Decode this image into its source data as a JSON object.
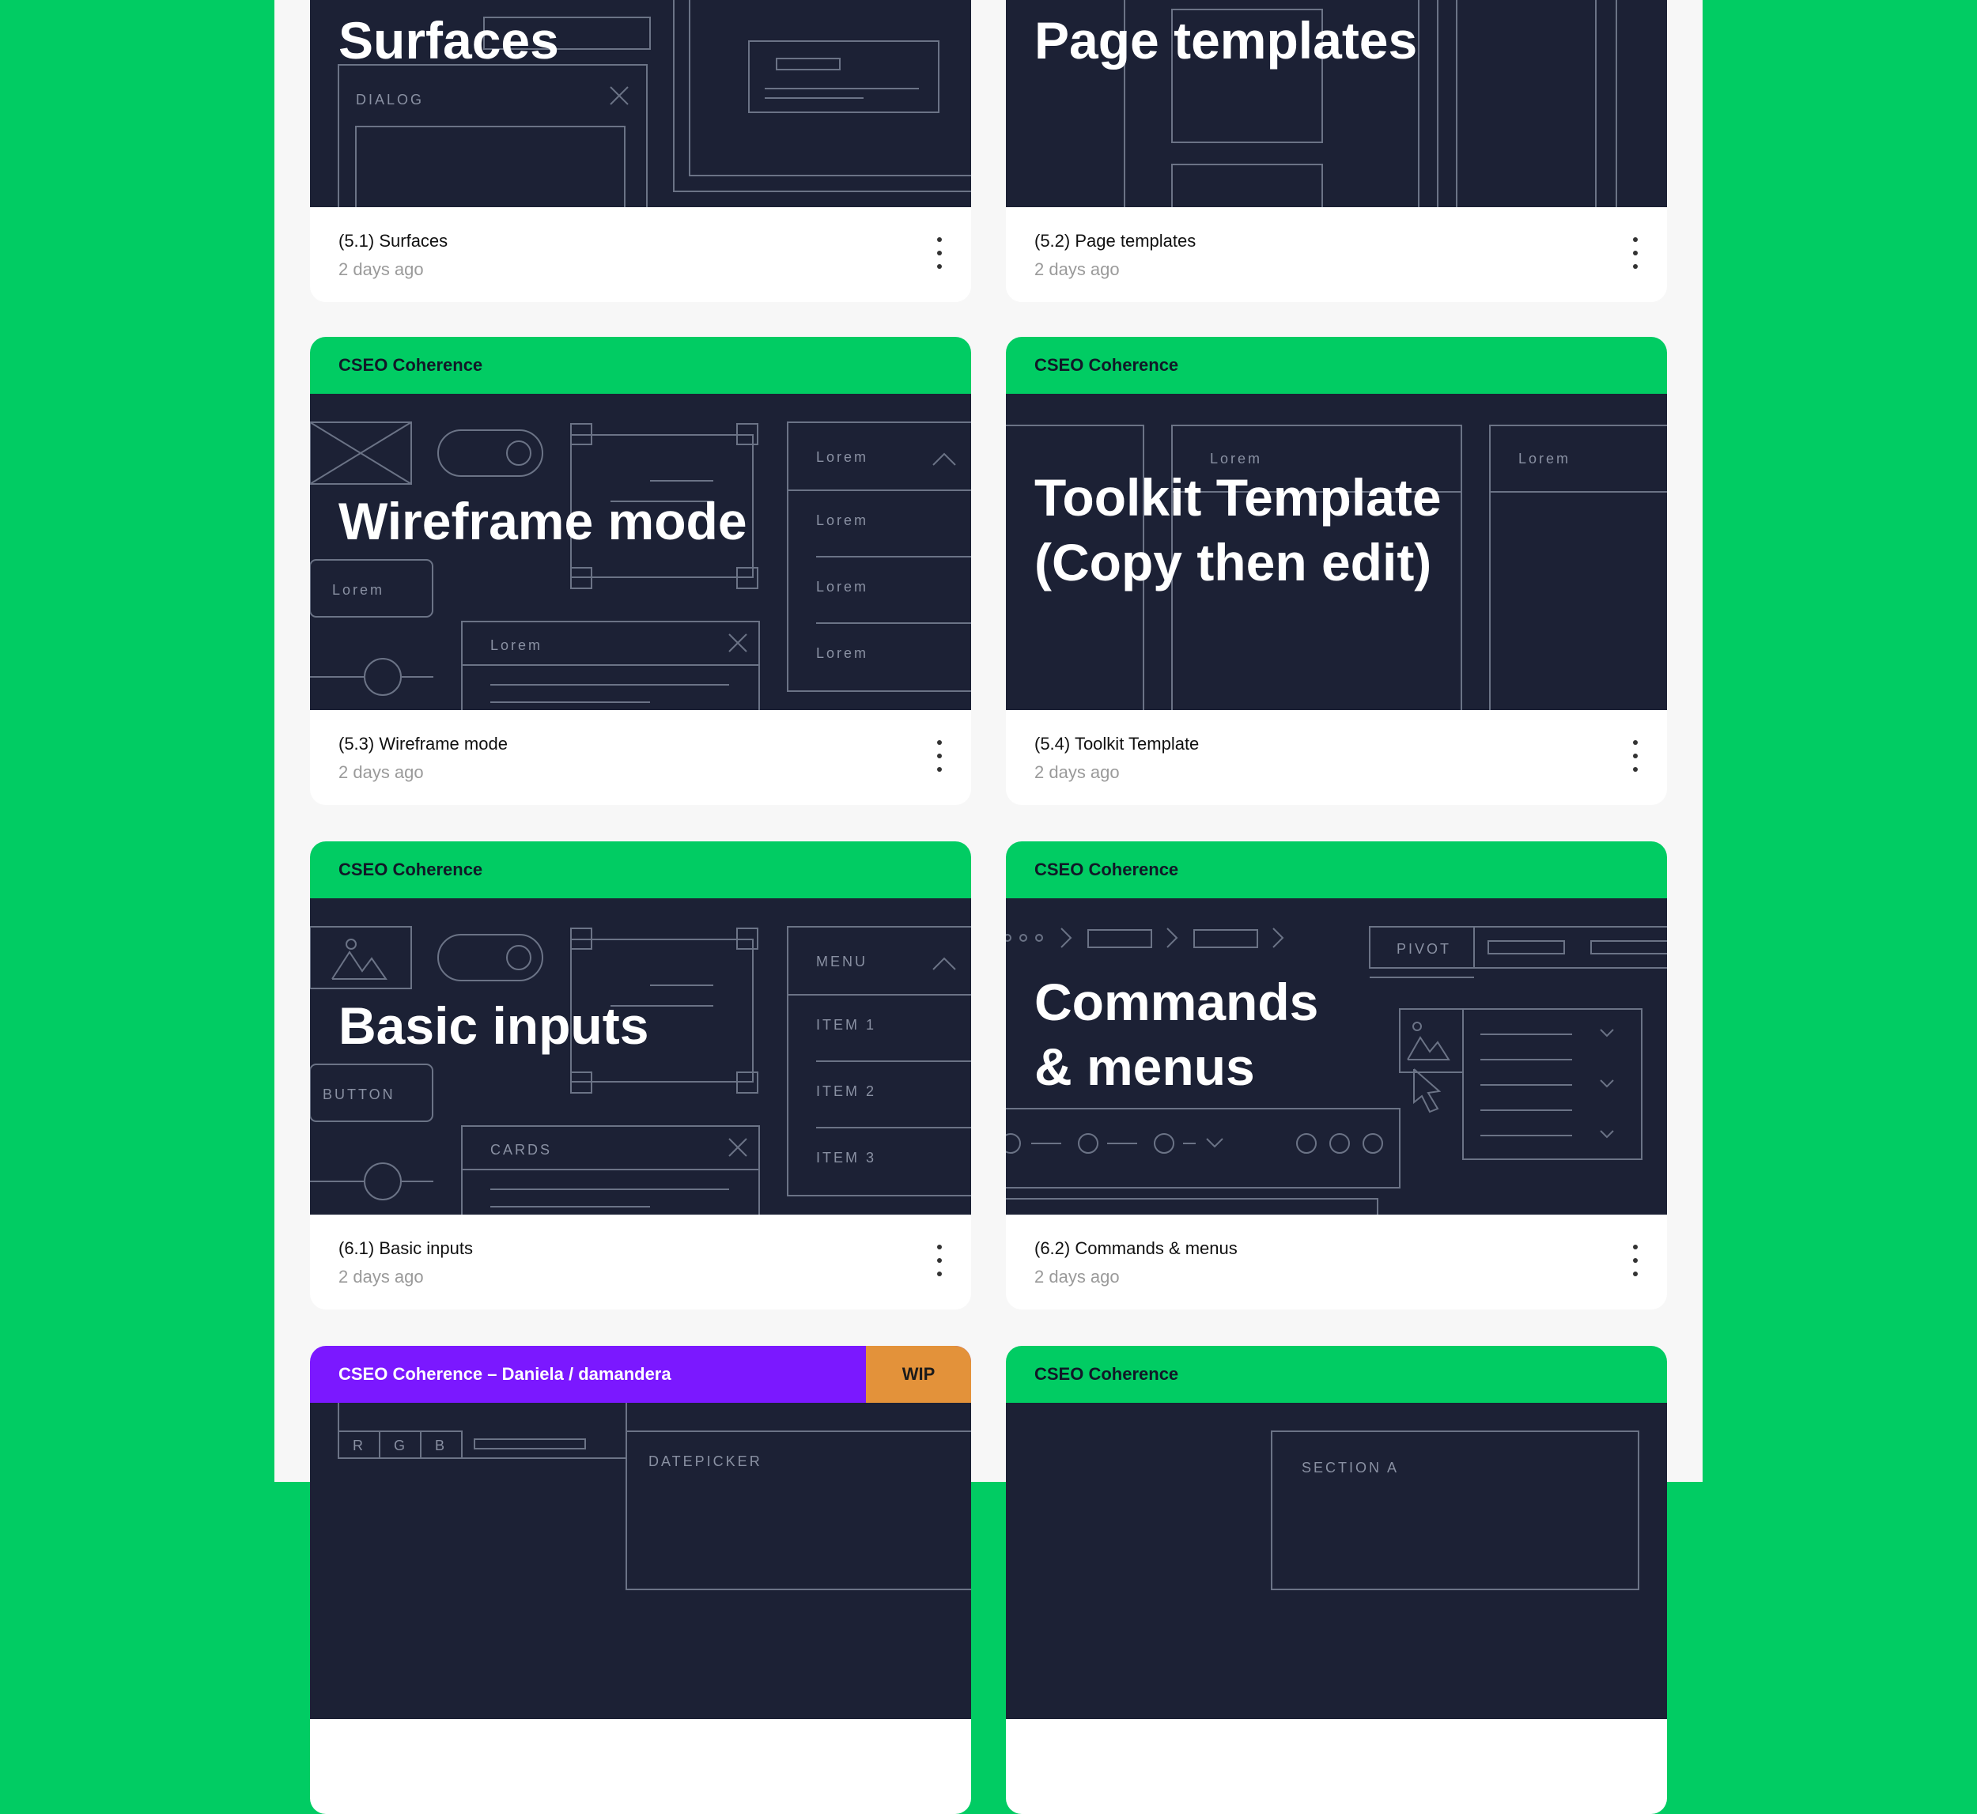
{
  "cards": [
    {
      "header": "",
      "thumb_title_lines": [
        "Surfaces"
      ],
      "thumb_labels": {
        "dialog": "DIALOG"
      },
      "file_name": "(5.1) Surfaces",
      "time": "2 days ago"
    },
    {
      "header": "",
      "thumb_title_lines": [
        "Page templates"
      ],
      "file_name": "(5.2) Page templates",
      "time": "2 days ago"
    },
    {
      "header": "CSEO Coherence",
      "thumb_title_lines": [
        "Wireframe mode"
      ],
      "thumb_labels": {
        "lorem": "Lorem"
      },
      "file_name": "(5.3) Wireframe mode",
      "time": "2 days ago"
    },
    {
      "header": "CSEO Coherence",
      "thumb_title_lines": [
        "Toolkit Template",
        "(Copy then edit)"
      ],
      "thumb_labels": {
        "lorem": "Lorem"
      },
      "file_name": "(5.4) Toolkit Template",
      "time": "2 days ago"
    },
    {
      "header": "CSEO Coherence",
      "thumb_title_lines": [
        "Basic inputs"
      ],
      "thumb_labels": {
        "button": "BUTTON",
        "cards": "CARDS",
        "menu": "MENU",
        "item1": "ITEM 1",
        "item2": "ITEM 2",
        "item3": "ITEM 3"
      },
      "file_name": "(6.1) Basic inputs",
      "time": "2 days ago"
    },
    {
      "header": "CSEO Coherence",
      "thumb_title_lines": [
        "Commands",
        "& menus"
      ],
      "thumb_labels": {
        "pivot": "PIVOT"
      },
      "file_name": "(6.2) Commands & menus",
      "time": "2 days ago"
    },
    {
      "header": "CSEO Coherence – Daniela / damandera",
      "badge": "WIP",
      "thumb_labels": {
        "r": "R",
        "g": "G",
        "b": "B",
        "datepicker": "DATEPICKER"
      }
    },
    {
      "header": "CSEO Coherence",
      "thumb_labels": {
        "section": "SECTION A"
      }
    }
  ],
  "colors": {
    "background": "#01cc63",
    "panel": "#f7f7f7",
    "thumb": "#1c2135",
    "header_green": "#01cc63",
    "header_purple": "#7b18ff",
    "wip": "#e3923a"
  },
  "icons": [
    "more-vertical-icon",
    "close-icon",
    "chevron-up-icon",
    "chevron-down-icon",
    "image-icon",
    "cursor-icon"
  ]
}
